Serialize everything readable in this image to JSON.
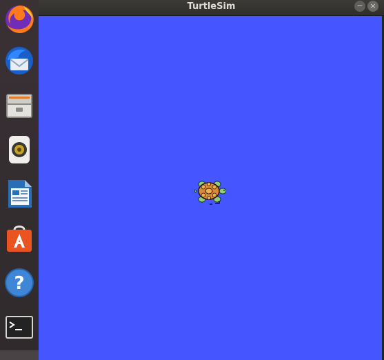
{
  "window": {
    "title": "TurtleSim",
    "minimize_glyph": "−",
    "close_glyph": "×",
    "canvas_color": "#4555ff"
  },
  "dock": {
    "items": [
      {
        "name": "firefox-icon"
      },
      {
        "name": "thunderbird-icon"
      },
      {
        "name": "files-icon"
      },
      {
        "name": "rhythmbox-icon"
      },
      {
        "name": "libreoffice-writer-icon"
      },
      {
        "name": "software-center-icon"
      },
      {
        "name": "help-icon"
      },
      {
        "name": "terminal-icon"
      }
    ]
  }
}
